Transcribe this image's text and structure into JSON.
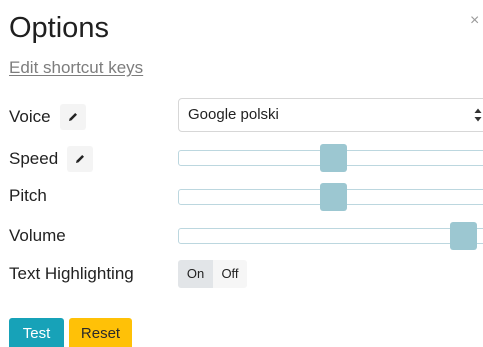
{
  "header": {
    "title": "Options",
    "close_glyph": "×",
    "close_icon": "close-icon"
  },
  "shortcut_link": "Edit shortcut keys",
  "voice": {
    "label": "Voice",
    "selected": "Google polski",
    "edit_icon": "pencil-icon"
  },
  "speed": {
    "label": "Speed",
    "value_fraction": 0.5,
    "edit_icon": "pencil-icon"
  },
  "pitch": {
    "label": "Pitch",
    "value_fraction": 0.5
  },
  "volume": {
    "label": "Volume",
    "value_fraction": 0.92
  },
  "text_highlighting": {
    "label": "Text Highlighting",
    "on_label": "On",
    "off_label": "Off",
    "selected": "On"
  },
  "buttons": {
    "test_label": "Test",
    "reset_label": "Reset"
  },
  "colors": {
    "test_button": "#17a2b8",
    "reset_button": "#ffc107",
    "slider_thumb": "#9cc7d1",
    "slider_border": "#bcd7df",
    "toggle_selected": "#e2e5e8"
  }
}
